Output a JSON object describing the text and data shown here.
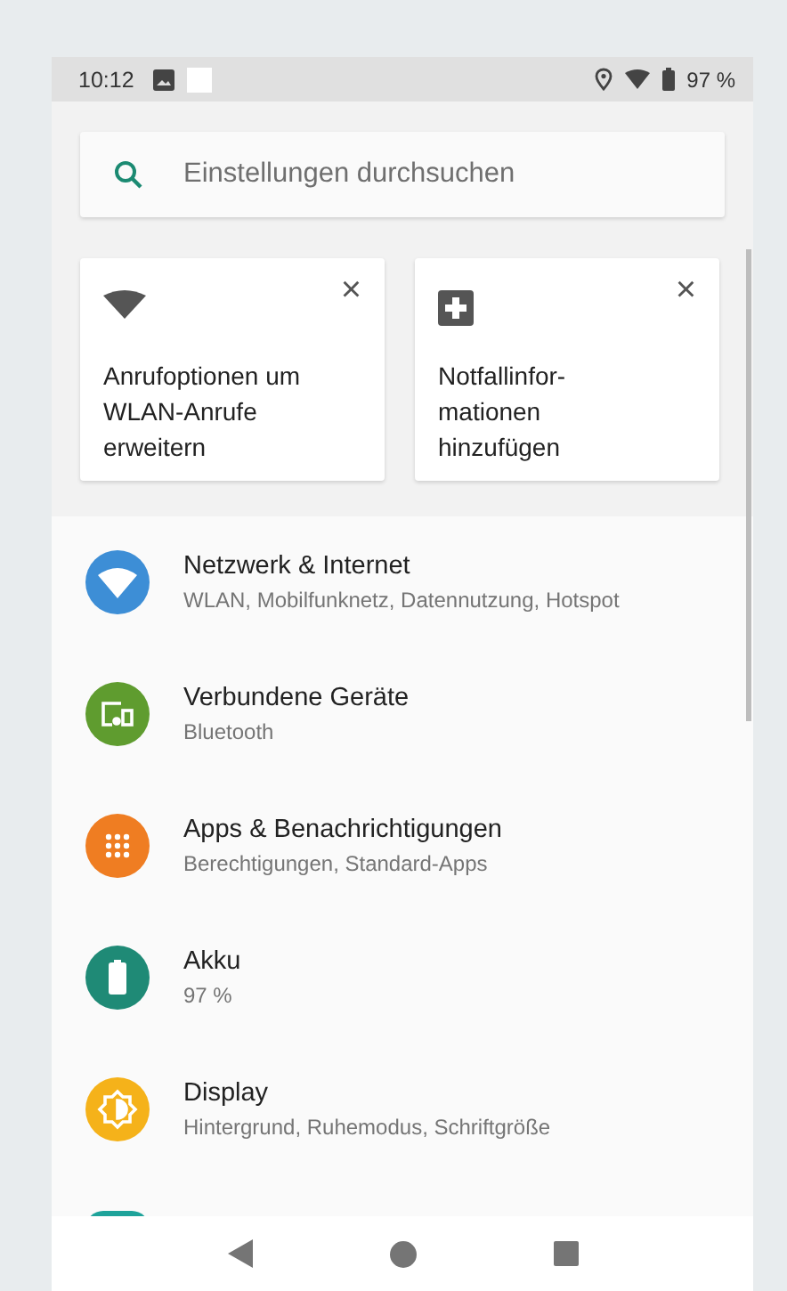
{
  "status_bar": {
    "time": "10:12",
    "battery": "97 %"
  },
  "search": {
    "placeholder": "Einstellungen durchsuchen"
  },
  "suggestions": [
    {
      "kind": "wifi",
      "text": "Anrufoptionen um WLAN-Anrufe erweitern",
      "close": "×"
    },
    {
      "kind": "medical",
      "text": "Notfallinfor-mationen hinzufügen",
      "close": "×"
    }
  ],
  "items": [
    {
      "kind": "network",
      "color": "#3d8ed6",
      "title": "Netzwerk & Internet",
      "subtitle": "WLAN, Mobilfunknetz, Datennutzung, Hotspot"
    },
    {
      "kind": "devices",
      "color": "#5f9c2f",
      "title": "Verbundene Geräte",
      "subtitle": "Bluetooth"
    },
    {
      "kind": "apps",
      "color": "#ef7d22",
      "title": "Apps & Benachrichtigungen",
      "subtitle": "Berechtigungen, Standard-Apps"
    },
    {
      "kind": "battery",
      "color": "#1f8a76",
      "title": "Akku",
      "subtitle": "97 %"
    },
    {
      "kind": "display",
      "color": "#f5b21a",
      "title": "Display",
      "subtitle": "Hintergrund, Ruhemodus, Schriftgröße"
    }
  ]
}
